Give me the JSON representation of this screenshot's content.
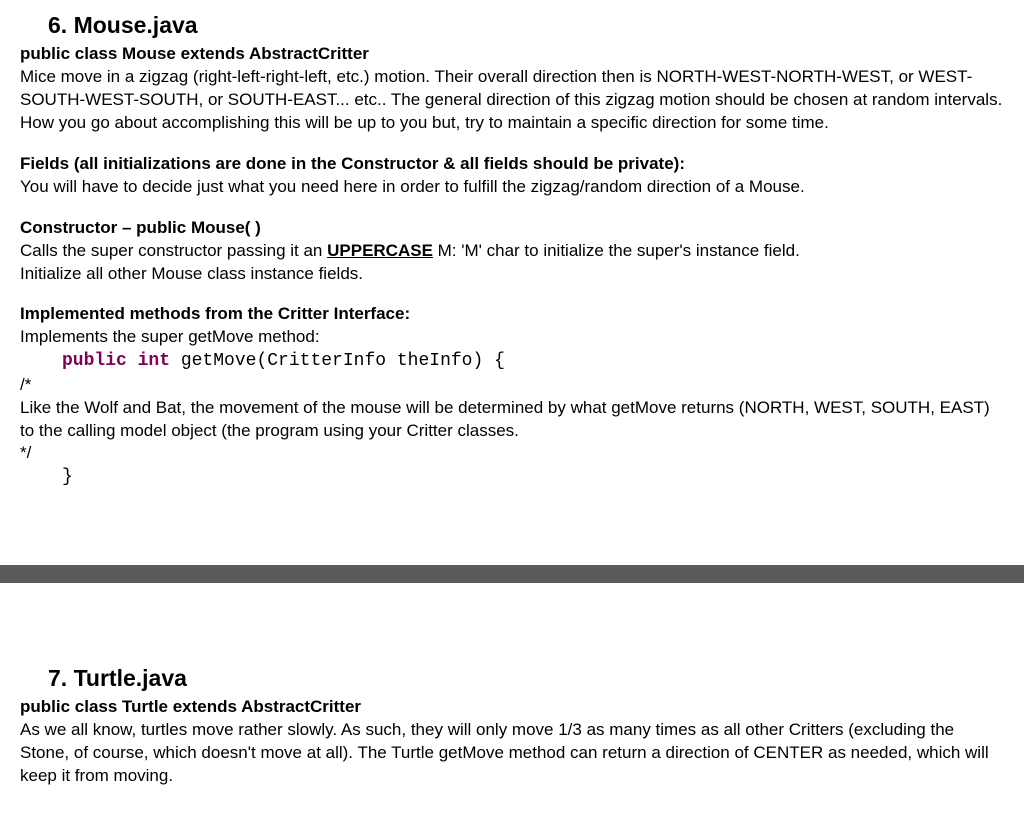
{
  "section6": {
    "heading": "6. Mouse.java",
    "classDecl": "public class Mouse extends AbstractCritter",
    "intro": "Mice move in a zigzag (right-left-right-left, etc.) motion.  Their overall direction then is NORTH-WEST-NORTH-WEST, or WEST-SOUTH-WEST-SOUTH, or SOUTH-EAST... etc..  The general direction of this zigzag motion should be chosen at random intervals. How you go about accomplishing this will be up to you but, try to maintain a specific direction for some time.",
    "fieldsHeading": "Fields (all initializations are done in the Constructor & all fields should be private):",
    "fieldsBody": "You will have to decide just what you need here in order to fulfill the zigzag/random direction of a Mouse.",
    "constructorHeading": "Constructor –   public Mouse( )",
    "constructorBody1a": "Calls the super constructor passing it an ",
    "constructorUpper": "UPPERCASE",
    "constructorBody1b": " M:  'M' char to initialize the super's instance field.",
    "constructorBody2": "Initialize all other Mouse class instance fields.",
    "implHeading": "Implemented methods from the Critter Interface:",
    "implLine": "Implements the super getMove method:",
    "codeKw1": "public",
    "codeKw2": "int",
    "codeRest": " getMove(CritterInfo theInfo) {",
    "commentOpenStar": "/*",
    "commentBody": "Like the Wolf and Bat, the movement of the mouse will be determined by what getMove returns (NORTH, WEST, SOUTH, EAST) to the calling model object (the program using your Critter classes.",
    "commentClose": "*/",
    "closeBrace": "}"
  },
  "section7": {
    "heading": "7. Turtle.java",
    "classDecl": "public class Turtle extends AbstractCritter",
    "intro": "As we all know, turtles move rather slowly.  As such, they will only move 1/3 as many times as all other Critters (excluding the Stone, of course, which doesn't move at all).  The Turtle getMove method can return a direction of CENTER as needed, which will keep it from moving."
  }
}
